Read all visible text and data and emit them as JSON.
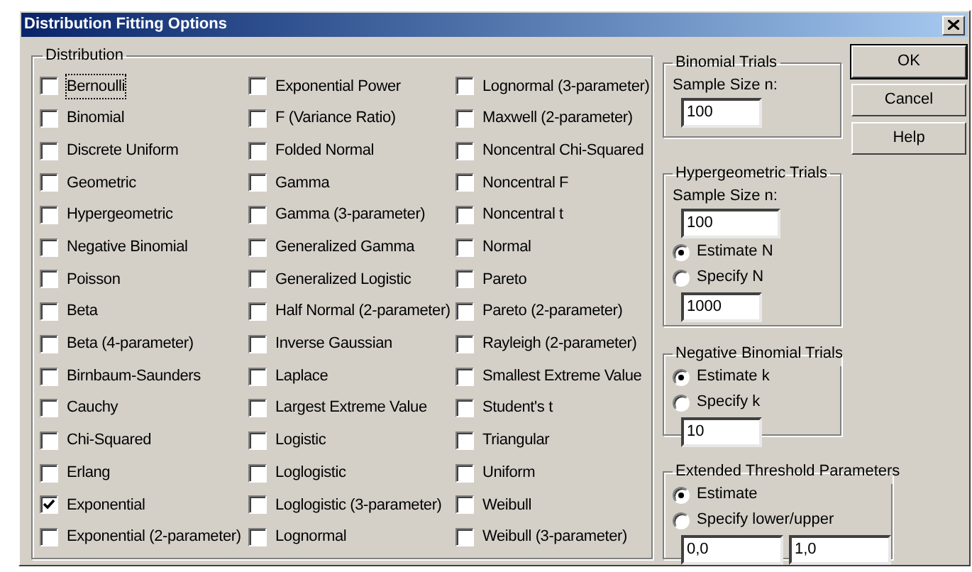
{
  "window": {
    "title": "Distribution Fitting Options"
  },
  "distribution": {
    "label": "Distribution",
    "items": [
      {
        "label": "Bernoulli",
        "checked": false,
        "focused": true
      },
      {
        "label": "Binomial",
        "checked": false
      },
      {
        "label": "Discrete Uniform",
        "checked": false
      },
      {
        "label": "Geometric",
        "checked": false
      },
      {
        "label": "Hypergeometric",
        "checked": false
      },
      {
        "label": "Negative Binomial",
        "checked": false
      },
      {
        "label": "Poisson",
        "checked": false
      },
      {
        "label": "Beta",
        "checked": false
      },
      {
        "label": "Beta (4-parameter)",
        "checked": false
      },
      {
        "label": "Birnbaum-Saunders",
        "checked": false
      },
      {
        "label": "Cauchy",
        "checked": false
      },
      {
        "label": "Chi-Squared",
        "checked": false
      },
      {
        "label": "Erlang",
        "checked": false
      },
      {
        "label": "Exponential",
        "checked": true
      },
      {
        "label": "Exponential (2-parameter)",
        "checked": false
      },
      {
        "label": "Exponential Power",
        "checked": false
      },
      {
        "label": "F (Variance Ratio)",
        "checked": false
      },
      {
        "label": "Folded Normal",
        "checked": false
      },
      {
        "label": "Gamma",
        "checked": false
      },
      {
        "label": "Gamma (3-parameter)",
        "checked": false
      },
      {
        "label": "Generalized Gamma",
        "checked": false
      },
      {
        "label": "Generalized Logistic",
        "checked": false
      },
      {
        "label": "Half Normal (2-parameter)",
        "checked": false
      },
      {
        "label": "Inverse Gaussian",
        "checked": false
      },
      {
        "label": "Laplace",
        "checked": false
      },
      {
        "label": "Largest Extreme Value",
        "checked": false
      },
      {
        "label": "Logistic",
        "checked": false
      },
      {
        "label": "Loglogistic",
        "checked": false
      },
      {
        "label": "Loglogistic (3-parameter)",
        "checked": false
      },
      {
        "label": "Lognormal",
        "checked": false
      },
      {
        "label": "Lognormal (3-parameter)",
        "checked": false
      },
      {
        "label": "Maxwell (2-parameter)",
        "checked": false
      },
      {
        "label": "Noncentral Chi-Squared",
        "checked": false
      },
      {
        "label": "Noncentral F",
        "checked": false
      },
      {
        "label": "Noncentral t",
        "checked": false
      },
      {
        "label": "Normal",
        "checked": false
      },
      {
        "label": "Pareto",
        "checked": false
      },
      {
        "label": "Pareto (2-parameter)",
        "checked": false
      },
      {
        "label": "Rayleigh (2-parameter)",
        "checked": false
      },
      {
        "label": "Smallest Extreme Value",
        "checked": false
      },
      {
        "label": "Student's t",
        "checked": false
      },
      {
        "label": "Triangular",
        "checked": false
      },
      {
        "label": "Uniform",
        "checked": false
      },
      {
        "label": "Weibull",
        "checked": false
      },
      {
        "label": "Weibull (3-parameter)",
        "checked": false
      }
    ]
  },
  "groups": [
    {
      "label": "Binomial Trials",
      "controls": [
        {
          "kind": "text",
          "text": "Sample Size n:"
        },
        {
          "kind": "field",
          "value": "100"
        }
      ]
    },
    {
      "label": "Hypergeometric Trials",
      "controls": [
        {
          "kind": "text",
          "text": "Sample Size n:"
        },
        {
          "kind": "field",
          "value": "100"
        },
        {
          "kind": "radio",
          "label": "Estimate N",
          "selected": true
        },
        {
          "kind": "radio",
          "label": "Specify N",
          "selected": false
        },
        {
          "kind": "field",
          "value": "1000"
        }
      ]
    },
    {
      "label": "Negative Binomial Trials",
      "controls": [
        {
          "kind": "radio",
          "label": "Estimate k",
          "selected": true
        },
        {
          "kind": "radio",
          "label": "Specify k",
          "selected": false
        },
        {
          "kind": "field",
          "value": "10"
        }
      ]
    },
    {
      "label": "Extended Threshold Parameters",
      "controls": [
        {
          "kind": "radio",
          "label": "Estimate",
          "selected": true
        },
        {
          "kind": "radio",
          "label": "Specify lower/upper",
          "selected": false
        },
        {
          "kind": "fieldpair",
          "values": [
            "0,0",
            "1,0"
          ]
        }
      ]
    }
  ],
  "buttons": [
    {
      "label": "OK",
      "default": true
    },
    {
      "label": "Cancel",
      "default": false
    },
    {
      "label": "Help",
      "default": false
    }
  ]
}
